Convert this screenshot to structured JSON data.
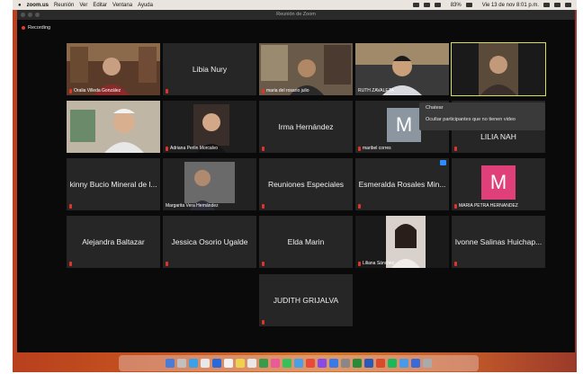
{
  "menubar": {
    "app": "zoom.us",
    "items": [
      "Reunión",
      "Ver",
      "Editar",
      "Ventana",
      "Ayuda"
    ],
    "battery": "83%",
    "datetime": "Vie 13 de nov 8:01 p.m."
  },
  "window": {
    "title": "Reunión de Zoom",
    "recording": "Recording"
  },
  "tiles": [
    {
      "name": "Oralia Villeda González",
      "video": true
    },
    {
      "name": "Libia Nury",
      "video": false
    },
    {
      "name": "maria del rosario julio",
      "video": true
    },
    {
      "name": "RUTH ZAVALETA",
      "video": true
    },
    {
      "name": "",
      "video": true
    },
    {
      "name": "",
      "video": true
    },
    {
      "name": "Adriana Perlin Morcalvo",
      "video": true
    },
    {
      "name": "Irma Hernández",
      "video": false
    },
    {
      "name": "maribel corres",
      "video": false,
      "avatar": "M"
    },
    {
      "name": "LILIA NAH",
      "video": false
    },
    {
      "name": "kinny Bucio Mineral de l...",
      "video": false
    },
    {
      "name": "Margarita Vera Hernández",
      "video": true
    },
    {
      "name": "Reuniones Especiales",
      "video": false
    },
    {
      "name": "Esmeralda Rosales Min...",
      "video": false
    },
    {
      "name": "MARIA PETRA HERNANDEZ",
      "video": false,
      "avatar": "M"
    },
    {
      "name": "Alejandra Baltazar",
      "video": false
    },
    {
      "name": "Jessica Osorio Ugalde",
      "video": false
    },
    {
      "name": "Elda Marin",
      "video": false
    },
    {
      "name": "Liliana Sánchez",
      "video": true
    },
    {
      "name": "Ivonne Salinas Huichap...",
      "video": false
    },
    {
      "name": "JUDITH GRIJALVA",
      "video": false
    }
  ],
  "context_menu": {
    "items": [
      "Chatear",
      "Ocultar participantes que no tienen video"
    ]
  },
  "colors": {
    "avatar_gray": "#8b96a0",
    "avatar_pink": "#e0407a",
    "mic_muted": "#e2332a",
    "highlight": "#d7e24a"
  }
}
